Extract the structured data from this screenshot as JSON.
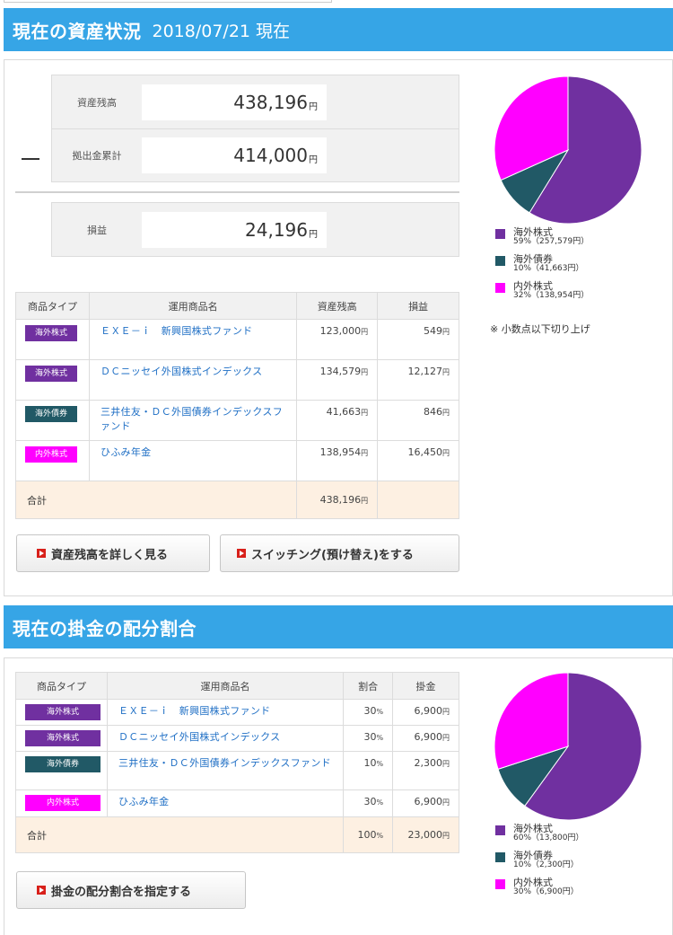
{
  "colors": {
    "overseas_stock": "#7030a0",
    "overseas_bond": "#215966",
    "domestic_overseas_stock": "#ff00ff",
    "header": "#36a5e6"
  },
  "asset": {
    "title": "現在の資産状況",
    "date": "2018/07/21 現在",
    "balance_label": "資産残高",
    "balance_value": "438,196",
    "contrib_label": "拠出金累計",
    "contrib_value": "414,000",
    "pl_label": "損益",
    "pl_value": "24,196",
    "unit": "円",
    "table": {
      "headers": [
        "商品タイプ",
        "運用商品名",
        "資産残高",
        "損益"
      ],
      "rows": [
        {
          "type": "海外株式",
          "name": "ＥＸＥ－ｉ　新興国株式ファンド",
          "balance": "123,000",
          "pl": "549"
        },
        {
          "type": "海外株式",
          "name": "ＤＣニッセイ外国株式インデックス",
          "balance": "134,579",
          "pl": "12,127"
        },
        {
          "type": "海外債券",
          "name": "三井住友・ＤＣ外国債券インデックスファンド",
          "balance": "41,663",
          "pl": "846"
        },
        {
          "type": "内外株式",
          "name": "ひふみ年金",
          "balance": "138,954",
          "pl": "16,450"
        }
      ],
      "total_label": "合計",
      "total_balance": "438,196"
    },
    "buttons": {
      "detail": "資産残高を詳しく見る",
      "switch": "スイッチング(預け替え)をする"
    },
    "legend": [
      {
        "name": "海外株式",
        "pct": "59%（257,579円）"
      },
      {
        "name": "海外債券",
        "pct": "10%（41,663円）"
      },
      {
        "name": "内外株式",
        "pct": "32%（138,954円）"
      }
    ],
    "note": "※ 小数点以下切り上げ"
  },
  "alloc": {
    "title": "現在の掛金の配分割合",
    "table": {
      "headers": [
        "商品タイプ",
        "運用商品名",
        "割合",
        "掛金"
      ],
      "rows": [
        {
          "type": "海外株式",
          "name": "ＥＸＥ－ｉ　新興国株式ファンド",
          "ratio": "30",
          "amount": "6,900"
        },
        {
          "type": "海外株式",
          "name": "ＤＣニッセイ外国株式インデックス",
          "ratio": "30",
          "amount": "6,900"
        },
        {
          "type": "海外債券",
          "name": "三井住友・ＤＣ外国債券インデックスファンド",
          "ratio": "10",
          "amount": "2,300"
        },
        {
          "type": "内外株式",
          "name": "ひふみ年金",
          "ratio": "30",
          "amount": "6,900"
        }
      ],
      "total_label": "合計",
      "total_ratio": "100",
      "total_amount": "23,000"
    },
    "pct_unit": "%",
    "unit": "円",
    "button": "掛金の配分割合を指定する",
    "legend": [
      {
        "name": "海外株式",
        "pct": "60%（13,800円）"
      },
      {
        "name": "海外債券",
        "pct": "10%（2,300円）"
      },
      {
        "name": "内外株式",
        "pct": "30%（6,900円）"
      }
    ]
  },
  "chart_data": [
    {
      "type": "pie",
      "categories": [
        "海外株式",
        "海外債券",
        "内外株式"
      ],
      "values": [
        257579,
        41663,
        138954
      ]
    },
    {
      "type": "pie",
      "categories": [
        "海外株式",
        "海外債券",
        "内外株式"
      ],
      "values": [
        13800,
        2300,
        6900
      ]
    }
  ]
}
